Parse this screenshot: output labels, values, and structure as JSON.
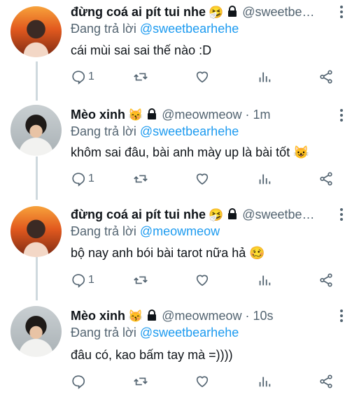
{
  "reply_prefix": "Đang trả lời",
  "tweets": [
    {
      "name": "đừng coá ai pít tui nhe",
      "emoji": "🤧",
      "handle": "@sweetbe…",
      "reply_to": "@sweetbearhehe",
      "text": "cái mùi sai sai thế nào :D",
      "reply_count": "1",
      "avatar": "fire-avatar"
    },
    {
      "name": "Mèo xinh",
      "emoji": "😽",
      "handle": "@meowmeow · 1m",
      "reply_to": "@sweetbearhehe",
      "text": "khôm sai đâu, bài anh mày up là bài tốt 😺",
      "reply_count": "1",
      "avatar": "boy-avatar"
    },
    {
      "name": "đừng coá ai pít tui nhe",
      "emoji": "🤧",
      "handle": "@sweetbe…",
      "reply_to": "@meowmeow",
      "text": "bộ nay anh bói bài tarot nữa hả 🥴",
      "reply_count": "1",
      "avatar": "fire-avatar"
    },
    {
      "name": "Mèo xinh",
      "emoji": "😽",
      "handle": "@meowmeow · 10s",
      "reply_to": "@sweetbearhehe",
      "text": "đâu có, kao bấm tay mà =))))",
      "reply_count": "",
      "avatar": "boy-avatar"
    }
  ]
}
